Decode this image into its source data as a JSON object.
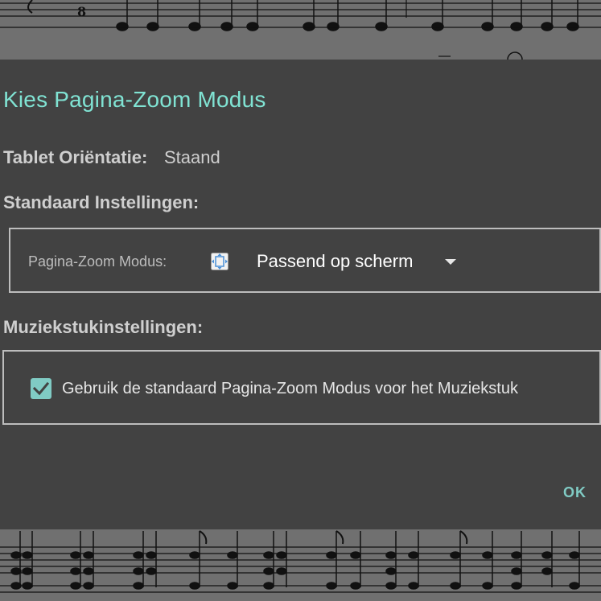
{
  "dialog": {
    "title": "Kies Pagina-Zoom Modus",
    "orientation_label": "Tablet Oriëntatie:",
    "orientation_value": "Staand",
    "default_settings_label": "Standaard Instellingen:",
    "zoom_mode_label": "Pagina-Zoom Modus:",
    "zoom_mode_icon": "fit-to-screen-icon",
    "zoom_mode_value": "Passend op scherm",
    "piece_settings_label": "Muziekstukinstellingen:",
    "use_default_checkbox_label": "Gebruik de standaard Pagina-Zoom Modus voor het Muziekstuk",
    "use_default_checked": true,
    "ok_label": "OK"
  },
  "colors": {
    "accent": "#80e3d3",
    "checkbox": "#80cbc4",
    "dialog_background": "#424242",
    "backdrop": "#707070"
  },
  "background": {
    "content": "sheet-music",
    "time_signature_numerator": "8"
  }
}
